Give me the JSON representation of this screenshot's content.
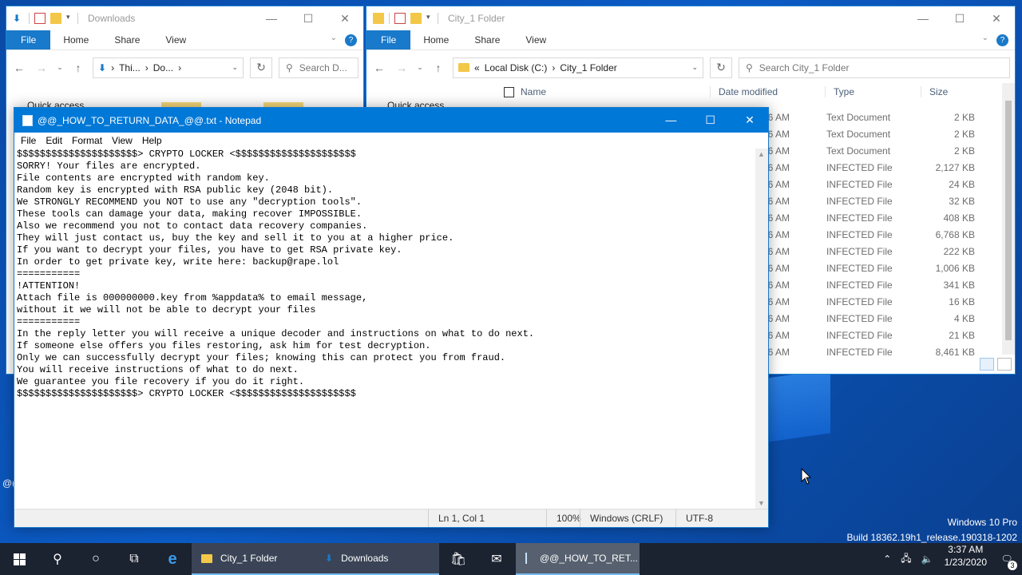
{
  "desktop": {
    "watermark_line1": "Windows 10 Pro",
    "watermark_line2": "Build 18362.19h1_release.190318-1202",
    "stray_text": "@("
  },
  "downloads_window": {
    "title": "Downloads",
    "tabs": [
      "File",
      "Home",
      "Share",
      "View"
    ],
    "address": {
      "part1": "Thi...",
      "part2": "Do..."
    },
    "search_placeholder": "Search D...",
    "nav_quick_access": "Quick access"
  },
  "city_window": {
    "title": "City_1 Folder",
    "tabs": [
      "File",
      "Home",
      "Share",
      "View"
    ],
    "address": {
      "prefix": "«",
      "part1": "Local Disk (C:)",
      "part2": "City_1 Folder"
    },
    "search_placeholder": "Search City_1 Folder",
    "nav_quick_access": "Quick access",
    "columns": {
      "name": "Name",
      "date": "Date modified",
      "type": "Type",
      "size": "Size"
    },
    "rows": [
      {
        "date": "36 AM",
        "type": "Text Document",
        "size": "2 KB"
      },
      {
        "date": "36 AM",
        "type": "Text Document",
        "size": "2 KB"
      },
      {
        "date": "36 AM",
        "type": "Text Document",
        "size": "2 KB"
      },
      {
        "date": "36 AM",
        "type": "INFECTED File",
        "size": "2,127 KB"
      },
      {
        "date": "36 AM",
        "type": "INFECTED File",
        "size": "24 KB"
      },
      {
        "date": "36 AM",
        "type": "INFECTED File",
        "size": "32 KB"
      },
      {
        "date": "36 AM",
        "type": "INFECTED File",
        "size": "408 KB"
      },
      {
        "date": "36 AM",
        "type": "INFECTED File",
        "size": "6,768 KB"
      },
      {
        "date": "36 AM",
        "type": "INFECTED File",
        "size": "222 KB"
      },
      {
        "date": "36 AM",
        "type": "INFECTED File",
        "size": "1,006 KB"
      },
      {
        "date": "36 AM",
        "type": "INFECTED File",
        "size": "341 KB"
      },
      {
        "date": "36 AM",
        "type": "INFECTED File",
        "size": "16 KB"
      },
      {
        "date": "36 AM",
        "type": "INFECTED File",
        "size": "4 KB"
      },
      {
        "date": "36 AM",
        "type": "INFECTED File",
        "size": "21 KB"
      },
      {
        "date": "36 AM",
        "type": "INFECTED File",
        "size": "8,461 KB"
      }
    ]
  },
  "notepad": {
    "title": "@@_HOW_TO_RETURN_DATA_@@.txt - Notepad",
    "menu": [
      "File",
      "Edit",
      "Format",
      "View",
      "Help"
    ],
    "content": "$$$$$$$$$$$$$$$$$$$$$> CRYPTO LOCKER <$$$$$$$$$$$$$$$$$$$$$\nSORRY! Your files are encrypted.\nFile contents are encrypted with random key.\nRandom key is encrypted with RSA public key (2048 bit).\nWe STRONGLY RECOMMEND you NOT to use any \"decryption tools\".\nThese tools can damage your data, making recover IMPOSSIBLE.\nAlso we recommend you not to contact data recovery companies.\nThey will just contact us, buy the key and sell it to you at a higher price.\nIf you want to decrypt your files, you have to get RSA private key.\nIn order to get private key, write here: backup@rape.lol\n===========\n!ATTENTION!\nAttach file is 000000000.key from %appdata% to email message,\nwithout it we will not be able to decrypt your files\n===========\nIn the reply letter you will receive a unique decoder and instructions on what to do next.\nIf someone else offers you files restoring, ask him for test decryption.\nOnly we can successfully decrypt your files; knowing this can protect you from fraud.\nYou will receive instructions of what to do next.\nWe guarantee you file recovery if you do it right.\n$$$$$$$$$$$$$$$$$$$$$> CRYPTO LOCKER <$$$$$$$$$$$$$$$$$$$$$",
    "status": {
      "position": "Ln 1, Col 1",
      "zoom": "100%",
      "eol": "Windows (CRLF)",
      "encoding": "UTF-8"
    }
  },
  "taskbar": {
    "apps": [
      {
        "label": "City_1 Folder"
      },
      {
        "label": "Downloads"
      },
      {
        "label": "@@_HOW_TO_RET..."
      }
    ],
    "time": "3:37 AM",
    "date": "1/23/2020",
    "notification_count": "3"
  }
}
